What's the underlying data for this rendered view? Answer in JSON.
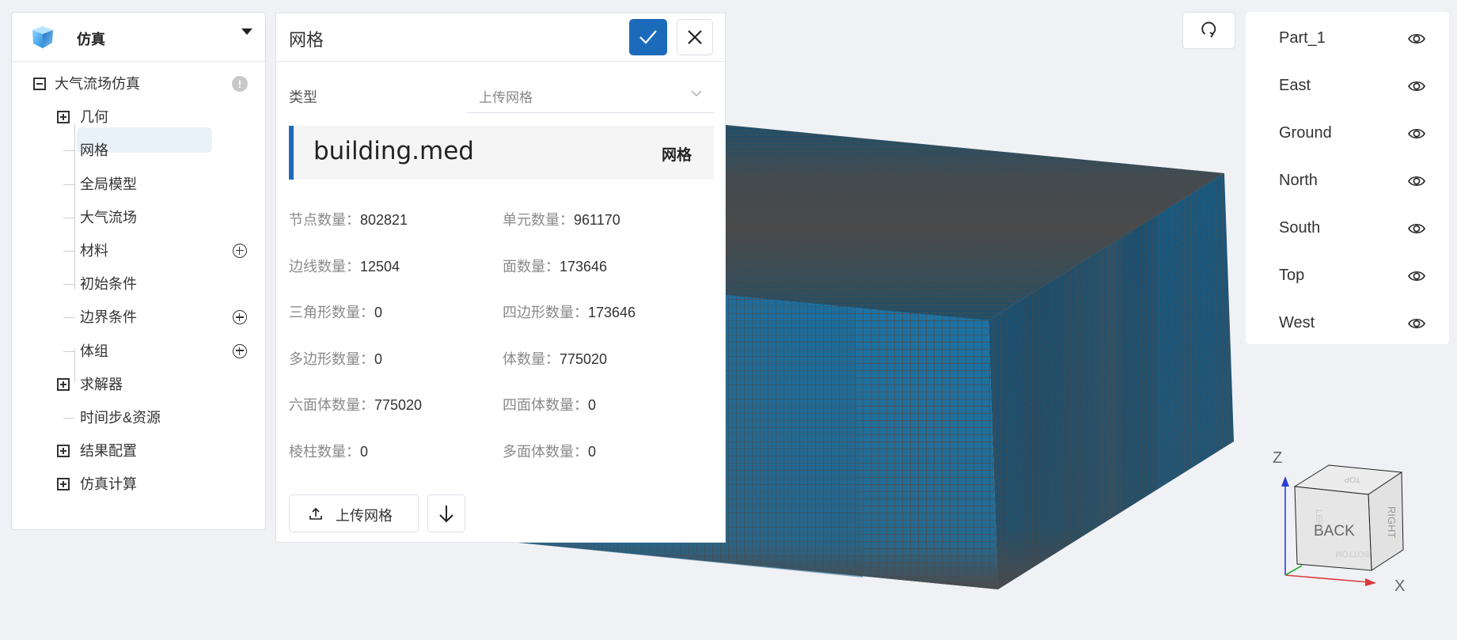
{
  "app": {
    "title": "仿真",
    "icon": "cube-logo-icon"
  },
  "sidebar": {
    "tree": [
      {
        "label": "大气流场仿真",
        "level": 0,
        "expander": "minus",
        "badge": "!"
      },
      {
        "label": "几何",
        "level": 1,
        "expander": "plus"
      },
      {
        "label": "网格",
        "level": 2,
        "selected": true
      },
      {
        "label": "全局模型",
        "level": 2
      },
      {
        "label": "大气流场",
        "level": 2
      },
      {
        "label": "材料",
        "level": 2,
        "action": "add"
      },
      {
        "label": "初始条件",
        "level": 2
      },
      {
        "label": "边界条件",
        "level": 2,
        "action": "add"
      },
      {
        "label": "体组",
        "level": 2,
        "action": "add"
      },
      {
        "label": "求解器",
        "level": 1,
        "expander": "plus"
      },
      {
        "label": "时间步&资源",
        "level": 2
      },
      {
        "label": "结果配置",
        "level": 1,
        "expander": "plus"
      },
      {
        "label": "仿真计算",
        "level": 1,
        "expander": "plus"
      }
    ]
  },
  "panel": {
    "title": "网格",
    "confirm_icon": "check-icon",
    "close_icon": "close-icon",
    "type_label": "类型",
    "type_value": "上传网格",
    "file": {
      "name": "building.med",
      "tag": "网格"
    },
    "stats": [
      {
        "key": "节点数量：",
        "value": "802821"
      },
      {
        "key": "单元数量：",
        "value": "961170"
      },
      {
        "key": "边线数量：",
        "value": "12504"
      },
      {
        "key": "面数量：",
        "value": "173646"
      },
      {
        "key": "三角形数量：",
        "value": "0"
      },
      {
        "key": "四边形数量：",
        "value": "173646"
      },
      {
        "key": "多边形数量：",
        "value": "0"
      },
      {
        "key": "体数量：",
        "value": "775020"
      },
      {
        "key": "六面体数量：",
        "value": "775020"
      },
      {
        "key": "四面体数量：",
        "value": "0"
      },
      {
        "key": "棱柱数量：",
        "value": "0"
      },
      {
        "key": "多面体数量：",
        "value": "0"
      }
    ],
    "upload_label": "上传网格",
    "download_icon": "arrow-down-icon"
  },
  "parts": [
    {
      "name": "Part_1",
      "visible": true
    },
    {
      "name": "East",
      "visible": true
    },
    {
      "name": "Ground",
      "visible": true
    },
    {
      "name": "North",
      "visible": true
    },
    {
      "name": "South",
      "visible": true
    },
    {
      "name": "Top",
      "visible": true
    },
    {
      "name": "West",
      "visible": true
    }
  ],
  "orientation": {
    "axis_z": "Z",
    "axis_x": "X",
    "face_front": "BACK",
    "face_top": "TOP",
    "face_right": "RIGHT",
    "face_bottom": "BOTTOM",
    "face_left": "LEFT"
  },
  "colors": {
    "accent": "#1c6bba",
    "mesh_face": "#1a74a8",
    "mesh_face_dark": "#154f72",
    "mesh_line": "#4a4a4a",
    "background": "#f0f1f5"
  }
}
